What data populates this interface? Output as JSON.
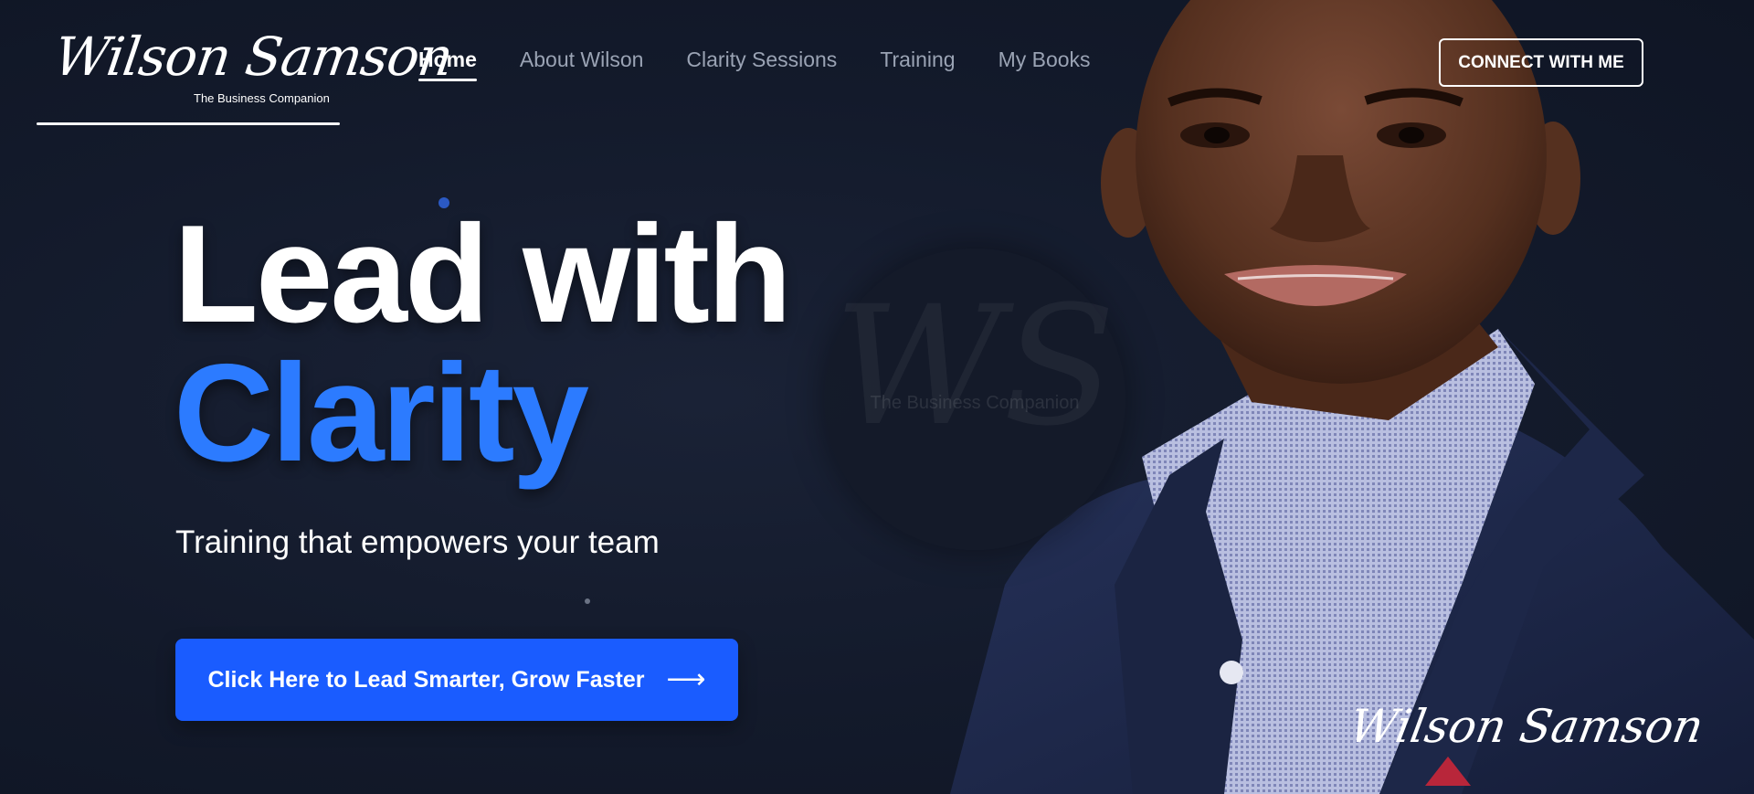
{
  "logo": {
    "script": "Wilson Samson",
    "tagline": "The Business Companion"
  },
  "nav": {
    "items": [
      {
        "label": "Home",
        "active": true
      },
      {
        "label": "About Wilson",
        "active": false
      },
      {
        "label": "Clarity Sessions",
        "active": false
      },
      {
        "label": "Training",
        "active": false
      },
      {
        "label": "My Books",
        "active": false
      }
    ]
  },
  "header": {
    "connect_label": "CONNECT WITH ME"
  },
  "hero": {
    "headline_line1": "Lead with",
    "headline_line2": "Clarity",
    "subheadline": "Training that empowers your team",
    "cta_label": "Click Here to Lead Smarter, Grow Faster",
    "cta_icon": "arrow-right-icon",
    "signature": "Wilson Samson"
  },
  "watermark": {
    "monogram": "WS",
    "tagline": "The Business Companion"
  },
  "colors": {
    "background": "#131a2b",
    "accent_blue": "#2c7bff",
    "cta_blue": "#1a5cff",
    "nav_inactive": "#9aa3b4"
  }
}
